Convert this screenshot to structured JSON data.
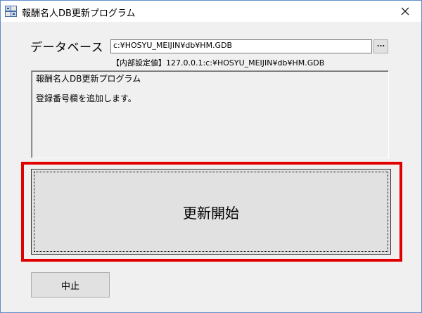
{
  "window": {
    "title": "報酬名人DB更新プログラム",
    "close_glyph": "✕"
  },
  "database": {
    "label": "データベース",
    "path_value": "c:¥HOSYU_MEIJIN¥db¥HM.GDB",
    "browse_label": "...",
    "internal_setting": "【内部設定値】127.0.0.1:c:¥HOSYU_MEIJIN¥db¥HM.GDB"
  },
  "log": {
    "lines": [
      "報酬名人DB更新プログラム",
      "登録番号欄を追加します。"
    ]
  },
  "actions": {
    "start_label": "更新開始",
    "cancel_label": "中止"
  },
  "colors": {
    "highlight": "#e00000",
    "window_bg": "#f0f0f0",
    "button_bg": "#e1e1e1"
  }
}
